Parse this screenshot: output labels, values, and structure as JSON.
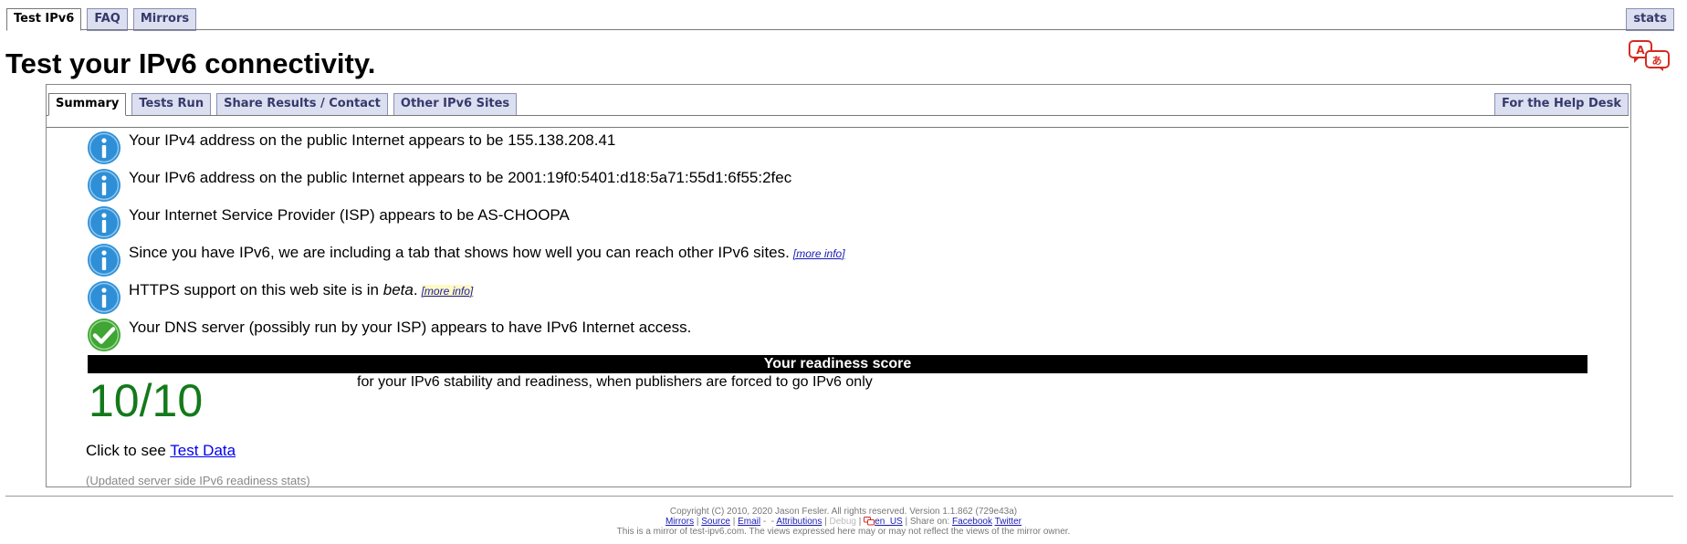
{
  "top_tabs": [
    {
      "label": "Test IPv6",
      "active": true
    },
    {
      "label": "FAQ",
      "active": false
    },
    {
      "label": "Mirrors",
      "active": false
    }
  ],
  "stats_label": "stats",
  "page_title": "Test your IPv6 connectivity.",
  "inner_tabs": [
    {
      "label": "Summary",
      "active": true
    },
    {
      "label": "Tests Run",
      "active": false
    },
    {
      "label": "Share Results / Contact",
      "active": false
    },
    {
      "label": "Other IPv6 Sites",
      "active": false
    }
  ],
  "helpdesk_label": "For the Help Desk",
  "results": [
    {
      "icon": "info-icon",
      "text": "Your IPv4 address on the public Internet appears to be 155.138.208.41"
    },
    {
      "icon": "info-icon",
      "text": "Your IPv6 address on the public Internet appears to be 2001:19f0:5401:d18:5a71:55d1:6f55:2fec"
    },
    {
      "icon": "info-icon",
      "text": "Your Internet Service Provider (ISP) appears to be AS-CHOOPA"
    },
    {
      "icon": "info-icon",
      "text": "Since you have IPv6, we are including a tab that shows how well you can reach other IPv6 sites.",
      "more": "[more info]"
    },
    {
      "icon": "info-icon",
      "text_before": "HTTPS support on this web site is in ",
      "text_em": "beta",
      "text_after": ".",
      "more": "[more info]"
    },
    {
      "icon": "check-icon",
      "text": "Your DNS server (possibly run by your ISP) appears to have IPv6 Internet access."
    }
  ],
  "score": {
    "heading": "Your readiness score",
    "value": "10/10",
    "description": "for your IPv6 stability and readiness, when publishers are forced to go IPv6 only"
  },
  "click_prefix": "Click to see ",
  "click_link": "Test Data",
  "updated_note": "(Updated server side IPv6 readiness stats)",
  "footer": {
    "copyright": "Copyright (C) 2010, 2020 Jason Fesler. All rights reserved. Version 1.1.862 (729e43a)",
    "links": [
      "Mirrors",
      "Source",
      "Email",
      "Attributions",
      "Debug"
    ],
    "locale": "en_US",
    "share_prefix": "Share on:",
    "share_links": [
      "Facebook",
      "Twitter"
    ],
    "mirror_note": "This is a mirror of test-ipv6.com. The views expressed here may or may not reflect the views of the mirror owner."
  },
  "colors": {
    "info": "#2e8fd6",
    "check": "#3fa534",
    "score": "#137a1b"
  }
}
